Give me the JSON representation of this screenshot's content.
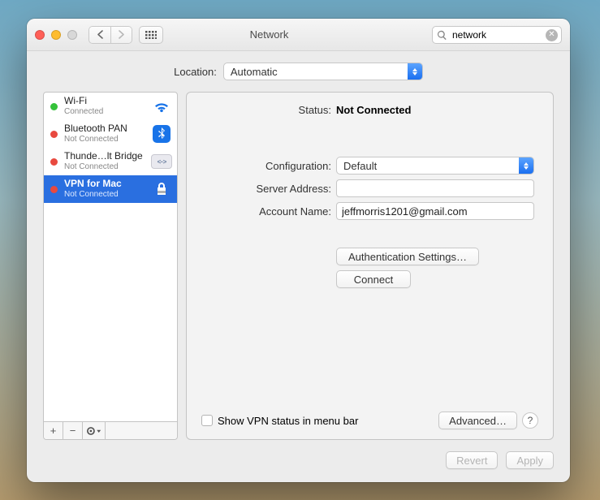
{
  "window": {
    "title": "Network"
  },
  "search": {
    "value": "network"
  },
  "location": {
    "label": "Location:",
    "value": "Automatic"
  },
  "services": [
    {
      "name": "Wi-Fi",
      "sub": "Connected",
      "status": "green",
      "icon": "wifi"
    },
    {
      "name": "Bluetooth PAN",
      "sub": "Not Connected",
      "status": "red",
      "icon": "bluetooth"
    },
    {
      "name": "Thunde…lt Bridge",
      "sub": "Not Connected",
      "status": "red",
      "icon": "thunderbolt"
    },
    {
      "name": "VPN for Mac",
      "sub": "Not Connected",
      "status": "red",
      "icon": "vpn",
      "selected": true
    }
  ],
  "detail": {
    "status_label": "Status:",
    "status_value": "Not Connected",
    "config_label": "Configuration:",
    "config_value": "Default",
    "server_label": "Server Address:",
    "server_value": "",
    "account_label": "Account Name:",
    "account_value": "jeffmorris1201@gmail.com",
    "auth_btn": "Authentication Settings…",
    "connect_btn": "Connect",
    "show_status_label": "Show VPN status in menu bar",
    "advanced_btn": "Advanced…"
  },
  "footer": {
    "revert": "Revert",
    "apply": "Apply"
  }
}
